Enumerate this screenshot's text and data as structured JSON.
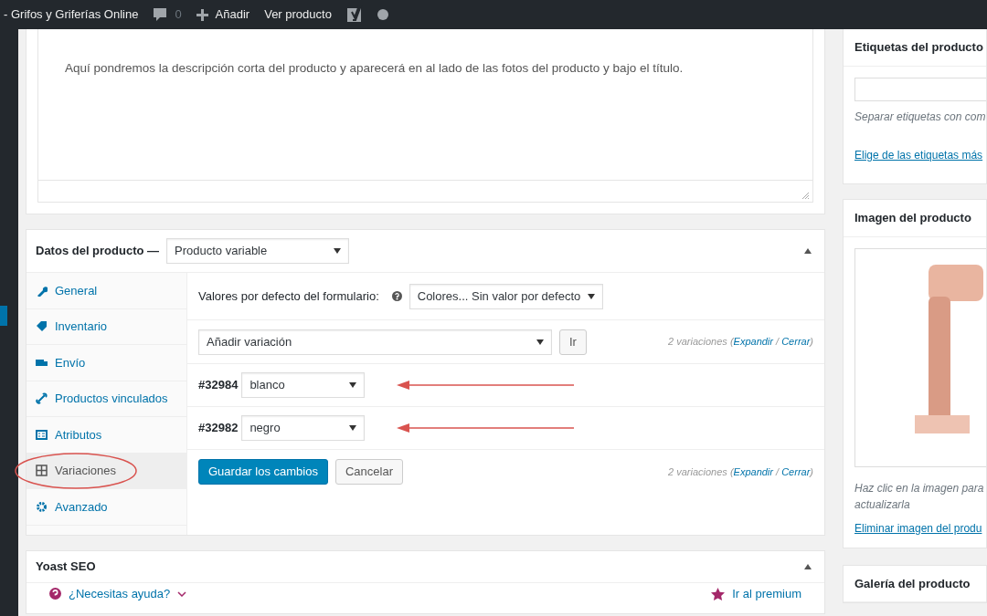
{
  "admin_bar": {
    "site_name": "- Grifos y Griferías Online",
    "comments": "0",
    "add_new": "Añadir",
    "view": "Ver producto"
  },
  "description": {
    "text": "Aquí pondremos la descripción corta del producto y aparecerá en al lado de las fotos del producto y bajo el título."
  },
  "product_data": {
    "title": "Datos del producto —",
    "type": "Producto variable",
    "tabs": [
      {
        "kind": "wrench",
        "label": "General",
        "selected": false,
        "circled": false
      },
      {
        "kind": "tag",
        "label": "Inventario",
        "selected": false,
        "circled": false
      },
      {
        "kind": "truck",
        "label": "Envío",
        "selected": false,
        "circled": false
      },
      {
        "kind": "link",
        "label": "Productos vinculados",
        "selected": false,
        "circled": false
      },
      {
        "kind": "list",
        "label": "Atributos",
        "selected": false,
        "circled": false
      },
      {
        "kind": "grid",
        "label": "Variaciones",
        "selected": true,
        "circled": true
      },
      {
        "kind": "gear",
        "label": "Avanzado",
        "selected": false,
        "circled": false
      }
    ],
    "defaults_label": "Valores por defecto del formulario:",
    "defaults_value": "Colores... Sin valor por defecto",
    "action_select": "Añadir variación",
    "go": "Ir",
    "summary": {
      "before": "2 variaciones (",
      "expand": "Expandir",
      "between": " / ",
      "collapse": "Cerrar",
      "after": ")"
    },
    "variations": [
      {
        "id": "#32984",
        "value": "blanco",
        "arrow": true
      },
      {
        "id": "#32982",
        "value": "negro",
        "arrow": true
      }
    ],
    "save": "Guardar los cambios",
    "cancel": "Cancelar",
    "summary_bottom": {
      "before": "2 variaciones (",
      "expand": "Expandir",
      "between": " / ",
      "collapse": "Cerrar",
      "after": ")"
    }
  },
  "yoast": {
    "title": "Yoast SEO",
    "help": "¿Necesitas ayuda?",
    "premium": "Ir al premium"
  },
  "sidebar": {
    "tags": {
      "title": "Etiquetas del producto",
      "hint": "Separar etiquetas con com",
      "link": "Elige de las etiquetas más"
    },
    "image": {
      "title": "Imagen del producto",
      "caption": [
        "Haz clic en la imagen para",
        "actualizarla"
      ],
      "link": "Eliminar imagen del produ"
    },
    "gallery": {
      "title": "Galería del producto"
    }
  }
}
